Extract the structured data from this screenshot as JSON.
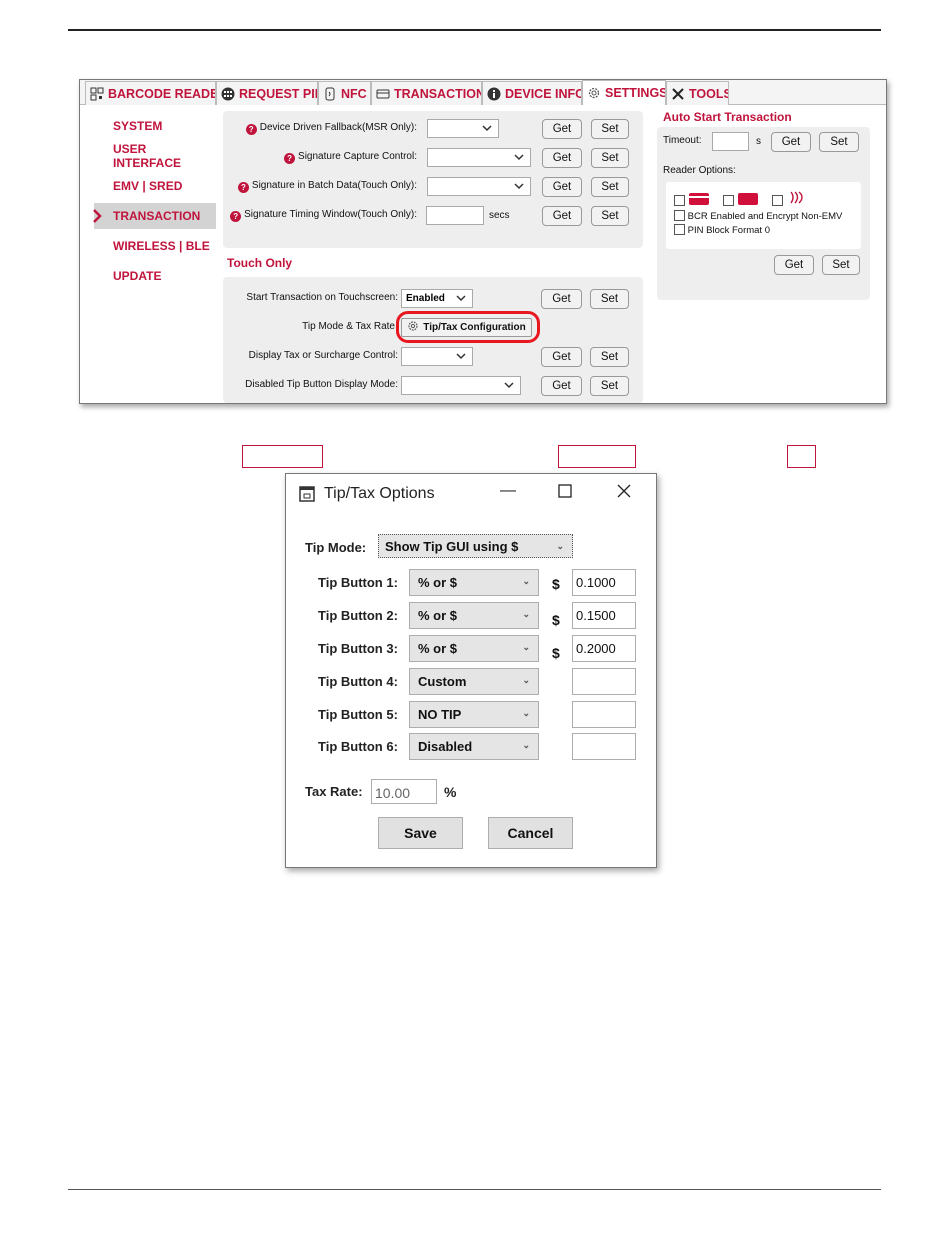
{
  "tabs": [
    {
      "label": "BARCODE READER",
      "icon": "barcode-icon"
    },
    {
      "label": "REQUEST PIN",
      "icon": "keypad-icon"
    },
    {
      "label": "NFC",
      "icon": "nfc-icon"
    },
    {
      "label": "TRANSACTION",
      "icon": "card-icon"
    },
    {
      "label": "DEVICE INFO",
      "icon": "info-icon"
    },
    {
      "label": "SETTINGS",
      "icon": "gear-icon"
    },
    {
      "label": "TOOLS",
      "icon": "tools-icon"
    }
  ],
  "sidebar": [
    {
      "label": "SYSTEM"
    },
    {
      "label": "USER INTERFACE"
    },
    {
      "label": "EMV | SRED"
    },
    {
      "label": "TRANSACTION"
    },
    {
      "label": "WIRELESS | BLE"
    },
    {
      "label": "UPDATE"
    }
  ],
  "top_panel": {
    "rows": [
      {
        "label": "Device Driven Fallback(MSR Only):",
        "value": ""
      },
      {
        "label": "Signature Capture Control:",
        "value": ""
      },
      {
        "label": "Signature in Batch Data(Touch Only):",
        "value": ""
      },
      {
        "label": "Signature Timing Window(Touch Only):",
        "value": "",
        "unit": "secs"
      }
    ]
  },
  "touch_only": {
    "title": "Touch Only",
    "start_label": "Start Transaction on Touchscreen:",
    "start_value": "Enabled",
    "tip_label": "Tip Mode & Tax Rate",
    "tip_button": "Tip/Tax Configuration",
    "display_tax_label": "Display Tax or Surcharge Control:",
    "display_tax_value": "",
    "disabled_tip_label": "Disabled Tip Button Display Mode:",
    "disabled_tip_value": ""
  },
  "auto_start": {
    "title": "Auto Start Transaction",
    "timeout_label": "Timeout:",
    "timeout_value": "",
    "timeout_unit": "s",
    "reader_options_label": "Reader Options:",
    "bcr_label": "BCR Enabled and Encrypt Non-EMV",
    "pin_label": "PIN Block Format 0"
  },
  "buttons": {
    "get": "Get",
    "set": "Set"
  },
  "dialog": {
    "title": "Tip/Tax Options",
    "tip_mode_label": "Tip Mode:",
    "tip_mode_value": "Show Tip GUI using $",
    "tip_buttons": [
      {
        "label": "Tip Button 1:",
        "mode": "% or $",
        "currency": "$",
        "value": "0.1000"
      },
      {
        "label": "Tip Button 2:",
        "mode": "% or $",
        "currency": "$",
        "value": "0.1500"
      },
      {
        "label": "Tip Button 3:",
        "mode": "% or $",
        "currency": "$",
        "value": "0.2000"
      },
      {
        "label": "Tip Button 4:",
        "mode": "Custom",
        "currency": "",
        "value": ""
      },
      {
        "label": "Tip Button 5:",
        "mode": "NO TIP",
        "currency": "",
        "value": ""
      },
      {
        "label": "Tip Button 6:",
        "mode": "Disabled",
        "currency": "",
        "value": ""
      }
    ],
    "tax_rate_label": "Tax Rate:",
    "tax_rate_value": "10.00",
    "tax_unit": "%",
    "save": "Save",
    "cancel": "Cancel"
  },
  "colors": {
    "accent": "#c0143c",
    "panel": "#eeeeee"
  }
}
